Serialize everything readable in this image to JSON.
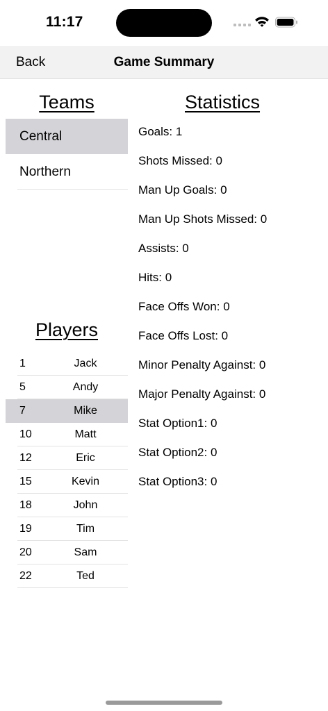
{
  "status_bar": {
    "time": "11:17"
  },
  "nav": {
    "back_label": "Back",
    "title": "Game Summary"
  },
  "teams": {
    "title": "Teams",
    "items": [
      {
        "label": "Central",
        "selected": true
      },
      {
        "label": "Northern",
        "selected": false
      }
    ]
  },
  "players": {
    "title": "Players",
    "items": [
      {
        "number": "1",
        "name": "Jack"
      },
      {
        "number": "5",
        "name": "Andy"
      },
      {
        "number": "7",
        "name": "Mike"
      },
      {
        "number": "10",
        "name": "Matt"
      },
      {
        "number": "12",
        "name": "Eric"
      },
      {
        "number": "15",
        "name": "Kevin"
      },
      {
        "number": "18",
        "name": "John"
      },
      {
        "number": "19",
        "name": "Tim"
      },
      {
        "number": "20",
        "name": "Sam"
      },
      {
        "number": "22",
        "name": "Ted"
      }
    ],
    "selected_index": 2
  },
  "statistics": {
    "title": "Statistics",
    "items": [
      "Goals: 1",
      "Shots Missed: 0",
      "Man Up Goals: 0",
      "Man Up Shots Missed: 0",
      "Assists: 0",
      "Hits: 0",
      "Face Offs Won: 0",
      "Face Offs Lost: 0",
      "Minor Penalty Against: 0",
      "Major Penalty Against: 0",
      "Stat Option1: 0",
      "Stat Option2: 0",
      "Stat Option3: 0"
    ]
  },
  "colors": {
    "selection": "#d4d4d8",
    "nav_background": "#f2f2f2"
  },
  "icons": [
    "wifi-icon",
    "battery-icon",
    "cellular-signal-icon"
  ]
}
